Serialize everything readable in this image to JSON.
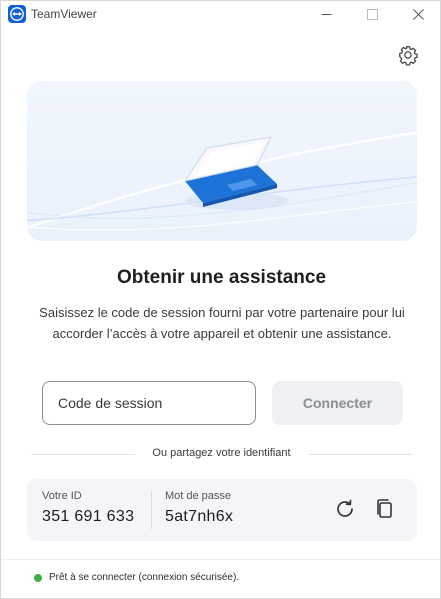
{
  "window": {
    "title": "TeamViewer"
  },
  "main": {
    "heading": "Obtenir une assistance",
    "description": "Saisissez le code de session fourni par votre partenaire pour lui accorder l’accès à votre appareil et obtenir une assistance.",
    "session_input": {
      "placeholder": "Code de session",
      "value": ""
    },
    "connect_label": "Connecter",
    "divider_text": "Ou partagez votre identifiant"
  },
  "credentials": {
    "id_label": "Votre ID",
    "id_value": "351 691 633",
    "password_label": "Mot de passe",
    "password_value": "5at7nh6x"
  },
  "status": {
    "text": "Prêt à se connecter (connexion sécurisée).",
    "color": "#3cb043"
  },
  "icons": {
    "logo": "teamviewer-logo-icon",
    "settings": "gear-icon",
    "refresh": "refresh-icon",
    "copy": "copy-icon"
  },
  "colors": {
    "accent": "#0e5fd8",
    "hero_bg": "#eef4fc"
  }
}
